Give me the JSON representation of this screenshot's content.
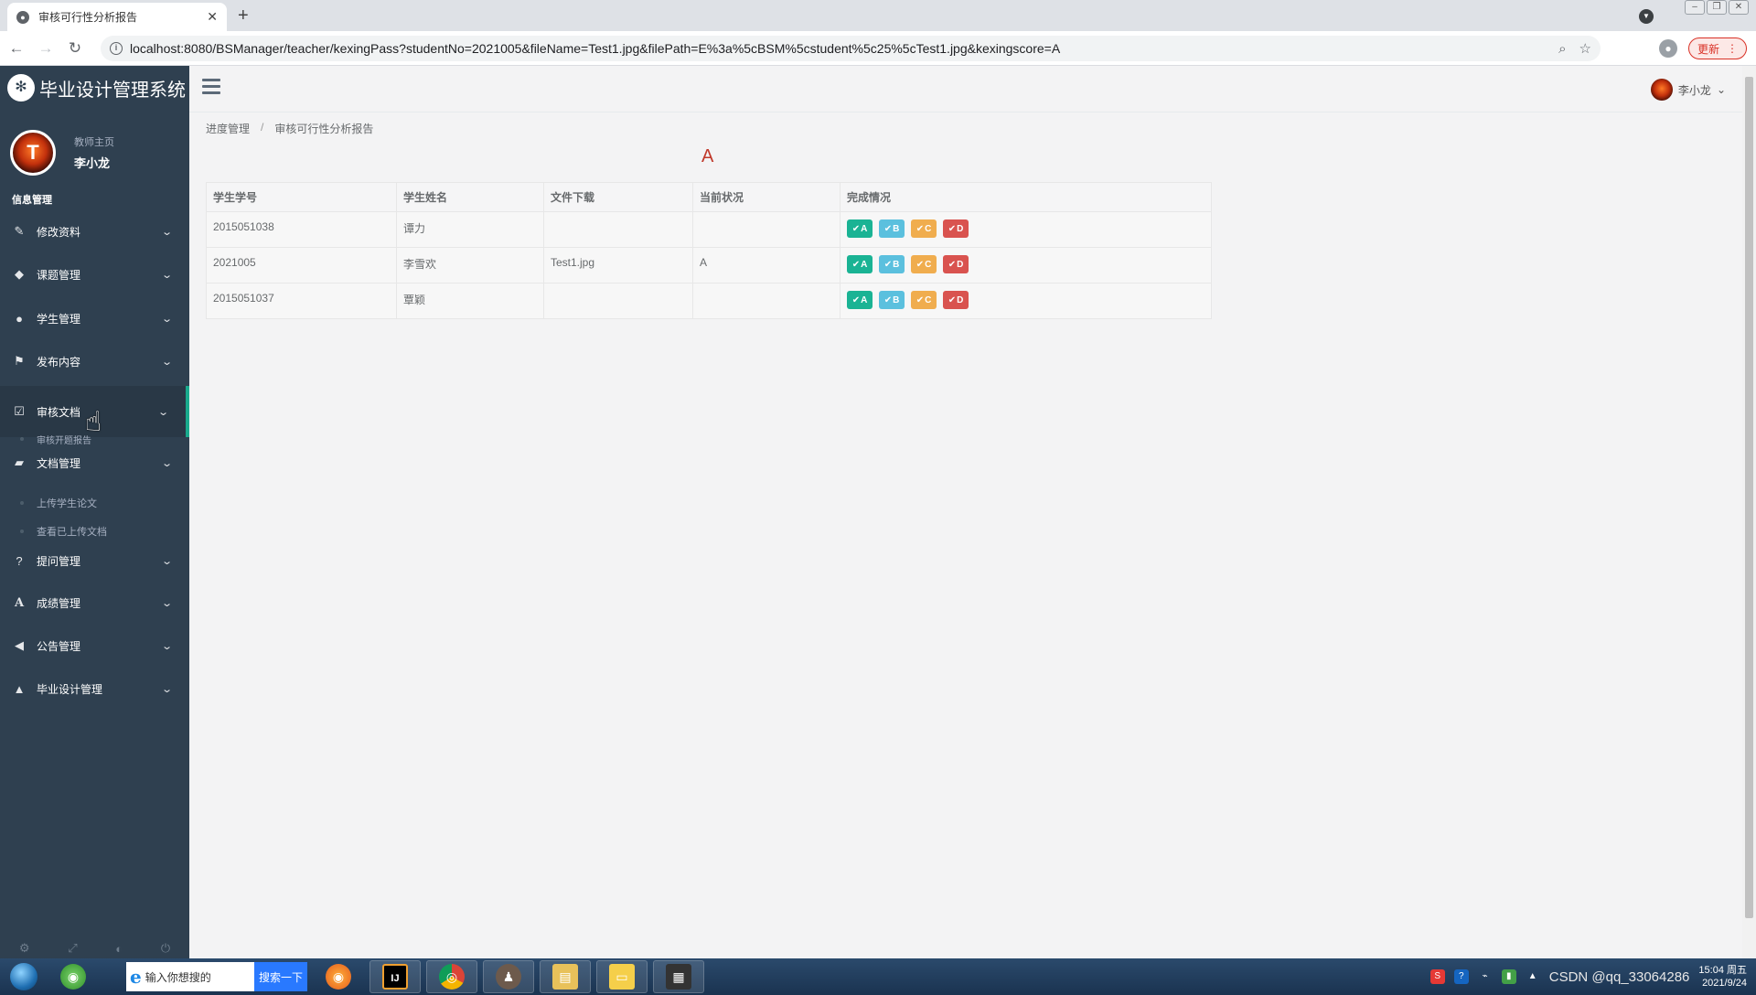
{
  "browser": {
    "tab_title": "审核可行性分析报告",
    "new_tab_symbol": "+",
    "url": "localhost:8080/BSManager/teacher/kexingPass?studentNo=2021005&fileName=Test1.jpg&filePath=E%3a%5cBSM%5cstudent%5c25%5cTest1.jpg&kexingscore=A",
    "update_label": "更新",
    "window_buttons": [
      "–",
      "❐",
      "✕"
    ]
  },
  "sidebar": {
    "brand_title": "毕业设计管理系统",
    "profile": {
      "role": "教师主页",
      "name": "李小龙",
      "avatar_letter": "T"
    },
    "section_title": "信息管理",
    "menu": [
      {
        "label": "修改资料",
        "icon": "edit-icon",
        "glyph": "✎"
      },
      {
        "label": "课题管理",
        "icon": "tags-icon",
        "glyph": "◆"
      },
      {
        "label": "学生管理",
        "icon": "user-icon",
        "glyph": "●"
      },
      {
        "label": "发布内容",
        "icon": "flag-icon",
        "glyph": "⚑"
      },
      {
        "label": "审核文档",
        "icon": "check-square-icon",
        "glyph": "☑"
      },
      {
        "label": "文档管理",
        "icon": "folder-open-icon",
        "glyph": "▰"
      },
      {
        "label": "提问管理",
        "icon": "question-circle-icon",
        "glyph": "?"
      },
      {
        "label": "成绩管理",
        "icon": "font-icon",
        "glyph": "A"
      },
      {
        "label": "公告管理",
        "icon": "bullhorn-icon",
        "glyph": "◀"
      },
      {
        "label": "毕业设计管理",
        "icon": "graduation-cap-icon",
        "glyph": "▲"
      }
    ],
    "submenu_review": [
      "审核开题报告"
    ],
    "submenu_docs": [
      "上传学生论文",
      "查看已上传文档"
    ],
    "chevron": "⌄"
  },
  "topnav": {
    "user_name": "李小龙",
    "user_caret": "⌄"
  },
  "breadcrumb": {
    "items": [
      "进度管理",
      "审核可行性分析报告"
    ],
    "separator": "/"
  },
  "score_display": "A",
  "table": {
    "headers": [
      "学生学号",
      "学生姓名",
      "文件下载",
      "当前状况",
      "完成情况"
    ],
    "rows": [
      {
        "student_no": "2015051038",
        "name": "谭力",
        "file": "",
        "status": ""
      },
      {
        "student_no": "2021005",
        "name": "李雪欢",
        "file": "Test1.jpg",
        "status": "A"
      },
      {
        "student_no": "2015051037",
        "name": "覃颖",
        "file": "",
        "status": ""
      }
    ],
    "grade_buttons": [
      "A",
      "B",
      "C",
      "D"
    ],
    "check_glyph": "✔",
    "colors": {
      "A": "#1ab394",
      "B": "#5bc0de",
      "C": "#f0ad4e",
      "D": "#d9534f"
    }
  },
  "taskbar": {
    "search_placeholder": "输入你想搜的",
    "search_button": "搜索一下",
    "apps": [
      "firefox-icon",
      "intellij-icon",
      "chrome-icon",
      "app-icon",
      "file-explorer-icon",
      "folder-icon",
      "terminal-icon"
    ],
    "app_glyphs": [
      "◉",
      "IJ",
      "◎",
      "♟",
      "▤",
      "▭",
      "▦"
    ],
    "tray_watermark": "CSDN @qq_33064286",
    "clock_time": "15:04 周五",
    "clock_date": "2021/9/24"
  },
  "colors": {
    "sidebar_bg": "#2f4050",
    "active_accent": "#19aa8d",
    "score_red": "#c0392b"
  }
}
